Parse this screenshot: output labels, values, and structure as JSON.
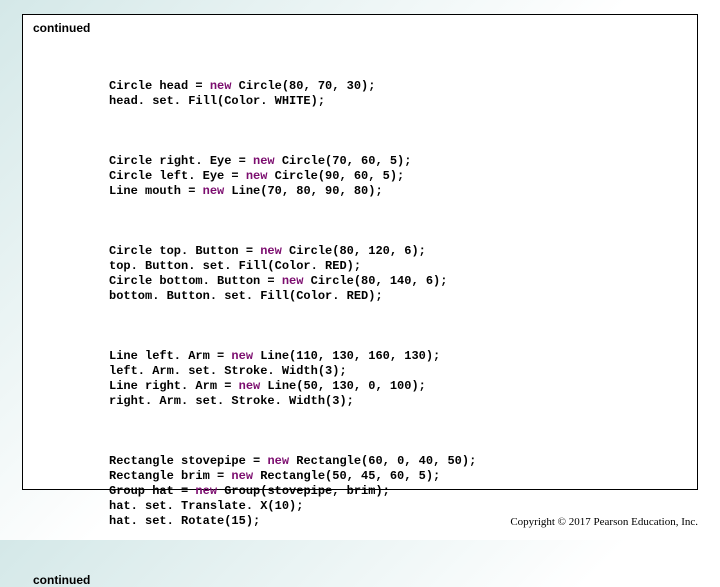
{
  "slide": {
    "continued_top": "continued",
    "continued_bottom": "continued",
    "copyright": "Copyright © 2017 Pearson Education, Inc."
  },
  "code": {
    "block1": {
      "line1_a": "Circle head = ",
      "line1_kw": "new",
      "line1_b": " Circle(80, 70, 30);",
      "line2": "head. set. Fill(Color. WHITE);"
    },
    "block2": {
      "line1_a": "Circle right. Eye = ",
      "line1_kw": "new",
      "line1_b": " Circle(70, 60, 5);",
      "line2_a": "Circle left. Eye = ",
      "line2_kw": "new",
      "line2_b": " Circle(90, 60, 5);",
      "line3_a": "Line mouth = ",
      "line3_kw": "new",
      "line3_b": " Line(70, 80, 90, 80);"
    },
    "block3": {
      "line1_a": "Circle top. Button = ",
      "line1_kw": "new",
      "line1_b": " Circle(80, 120, 6);",
      "line2": "top. Button. set. Fill(Color. RED);",
      "line3_a": "Circle bottom. Button = ",
      "line3_kw": "new",
      "line3_b": " Circle(80, 140, 6);",
      "line4": "bottom. Button. set. Fill(Color. RED);"
    },
    "block4": {
      "line1_a": "Line left. Arm = ",
      "line1_kw": "new",
      "line1_b": " Line(110, 130, 160, 130);",
      "line2": "left. Arm. set. Stroke. Width(3);",
      "line3_a": "Line right. Arm = ",
      "line3_kw": "new",
      "line3_b": " Line(50, 130, 0, 100);",
      "line4": "right. Arm. set. Stroke. Width(3);"
    },
    "block5": {
      "line1_a": "Rectangle stovepipe = ",
      "line1_kw": "new",
      "line1_b": " Rectangle(60, 0, 40, 50);",
      "line2_a": "Rectangle brim = ",
      "line2_kw": "new",
      "line2_b": " Rectangle(50, 45, 60, 5);",
      "line3_a": "Group hat = ",
      "line3_kw": "new",
      "line3_b": " Group(stovepipe, brim);",
      "line4": "hat. set. Translate. X(10);",
      "line5": "hat. set. Rotate(15);"
    }
  }
}
